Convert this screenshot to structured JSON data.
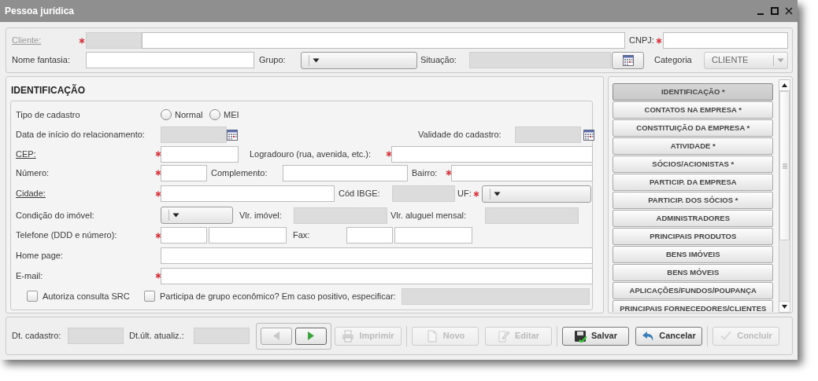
{
  "window": {
    "title": "Pessoa jurídica"
  },
  "header": {
    "cliente": {
      "label": "Cliente:",
      "link": true,
      "label_disabled": true,
      "required": true,
      "code": {
        "disabled": true
      },
      "name": {
        "disabled": false
      }
    },
    "cnpj": {
      "label": "CNPJ:",
      "required": true,
      "disabled": false
    },
    "nome_fantasia": {
      "label": "Nome fantasia:",
      "disabled": false
    },
    "grupo": {
      "label": "Grupo:",
      "disabled": false
    },
    "situacao": {
      "label": "Situação:",
      "disabled": true
    },
    "categoria": {
      "label": "Categoria",
      "value": "CLIENTE",
      "disabled": true
    }
  },
  "identificacao": {
    "title": "IDENTIFICAÇÃO",
    "tipo_cadastro": {
      "label": "Tipo de cadastro",
      "options": [
        {
          "label": "Normal",
          "selected": false
        },
        {
          "label": "MEI",
          "selected": false
        }
      ]
    },
    "data_inicio": {
      "label": "Data de início do relacionamento:",
      "disabled": true
    },
    "validade": {
      "label": "Validade do cadastro:",
      "disabled": true
    },
    "cep": {
      "label": "CEP:",
      "link": true,
      "required": true,
      "disabled": false
    },
    "logradouro": {
      "label": "Logradouro (rua, avenida, etc.):",
      "required": true,
      "disabled": false
    },
    "numero": {
      "label": "Número:",
      "required": true,
      "disabled": false
    },
    "complemento": {
      "label": "Complemento:",
      "disabled": false
    },
    "bairro": {
      "label": "Bairro:",
      "required": true,
      "disabled": false
    },
    "cidade": {
      "label": "Cidade:",
      "link": true,
      "required": true,
      "disabled": false
    },
    "cod_ibge": {
      "label": "Cód IBGE:",
      "disabled": true
    },
    "uf": {
      "label": "UF:",
      "required": true,
      "disabled": false
    },
    "condicao": {
      "label": "Condição do imóvel:",
      "disabled": false
    },
    "vlr_imovel": {
      "label": "Vlr. imóvel:",
      "disabled": true
    },
    "vlr_aluguel": {
      "label": "Vlr. aluguel mensal:",
      "disabled": true
    },
    "telefone": {
      "label": "Telefone (DDD e número):",
      "required": true,
      "disabled": false
    },
    "fax": {
      "label": "Fax:",
      "disabled": false
    },
    "home_page": {
      "label": "Home page:",
      "disabled": false
    },
    "email": {
      "label": "E-mail:",
      "required": true,
      "disabled": false
    },
    "autoriza": {
      "label": "Autoriza consulta SRC",
      "checked": false
    },
    "participa": {
      "label": "Participa de grupo econômico? Em caso positivo, especificar:",
      "checked": false,
      "disabled": true
    }
  },
  "sections": [
    {
      "label": "IDENTIFICAÇÃO *",
      "selected": true
    },
    {
      "label": "CONTATOS NA EMPRESA *",
      "selected": false
    },
    {
      "label": "CONSTITUIÇÃO DA EMPRESA *",
      "selected": false
    },
    {
      "label": "ATIVIDADE *",
      "selected": false
    },
    {
      "label": "SÓCIOS/ACIONISTAS *",
      "selected": false
    },
    {
      "label": "PARTICIP. DA EMPRESA",
      "selected": false
    },
    {
      "label": "PARTICIP. DOS SÓCIOS *",
      "selected": false
    },
    {
      "label": "ADMINISTRADORES",
      "selected": false
    },
    {
      "label": "PRINCIPAIS PRODUTOS",
      "selected": false
    },
    {
      "label": "BENS IMÓVEIS",
      "selected": false
    },
    {
      "label": "BENS MÓVEIS",
      "selected": false
    },
    {
      "label": "APLICAÇÕES/FUNDOS/POUPANÇA",
      "selected": false
    },
    {
      "label": "PRINCIPAIS FORNECEDORES/CLIENTES",
      "selected": false
    }
  ],
  "footer": {
    "dt_cadastro": {
      "label": "Dt. cadastro:",
      "disabled": true
    },
    "dt_atualiz": {
      "label": "Dt.últ. atualiz.:",
      "disabled": true
    },
    "nav": [
      {
        "kind": "prev",
        "disabled": true
      },
      {
        "kind": "next",
        "disabled": false
      }
    ],
    "button_groups": [
      [
        {
          "kind": "print",
          "label": "Imprimir",
          "disabled": true
        }
      ],
      [
        {
          "kind": "new",
          "label": "Novo",
          "disabled": true
        },
        {
          "kind": "edit",
          "label": "Editar",
          "disabled": true
        }
      ],
      [
        {
          "kind": "save",
          "label": "Salvar",
          "disabled": false
        },
        {
          "kind": "cancel",
          "label": "Cancelar",
          "disabled": false
        }
      ],
      [
        {
          "kind": "conclude",
          "label": "Concluir",
          "disabled": true
        }
      ]
    ]
  }
}
